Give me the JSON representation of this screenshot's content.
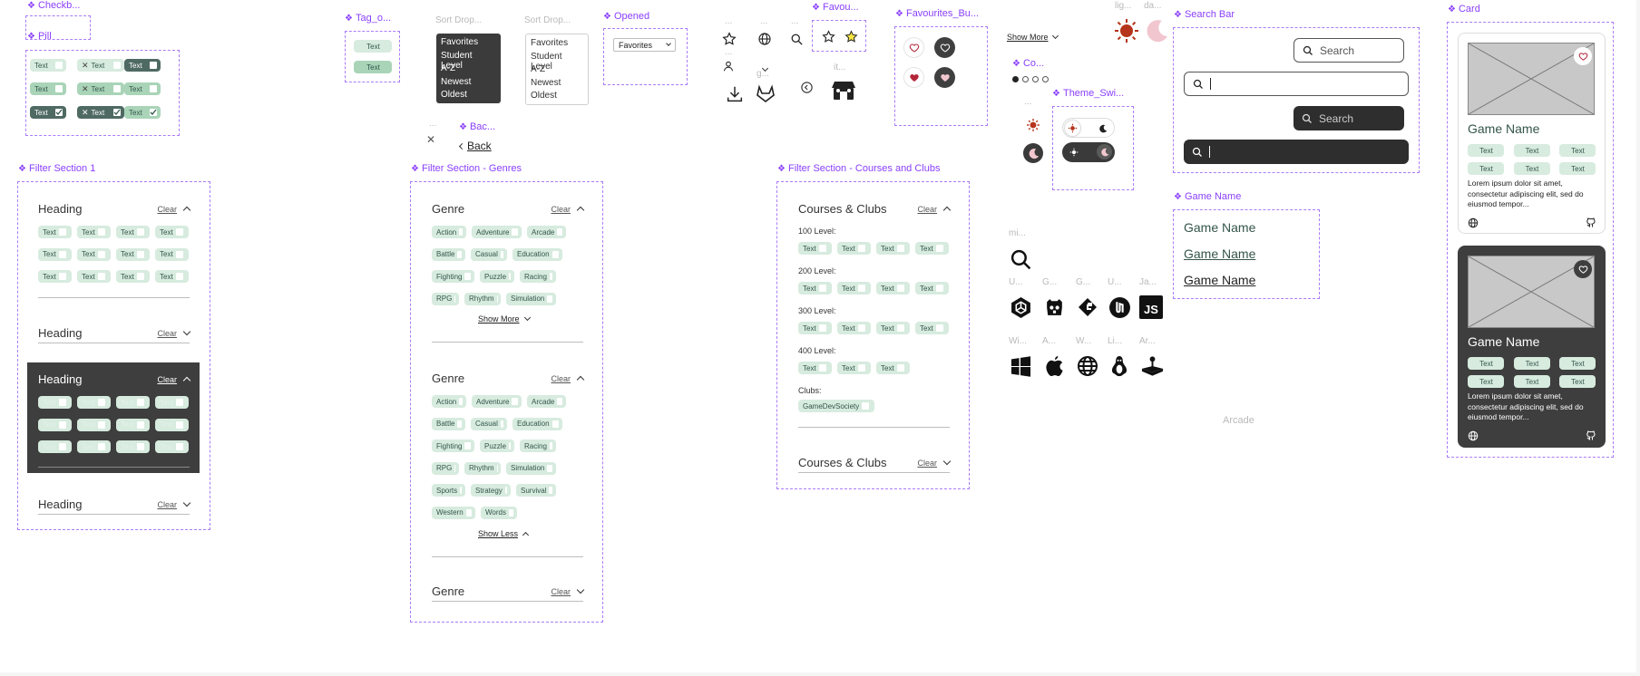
{
  "labels": {
    "checkbox": "Checkb...",
    "pill": "Pill",
    "tag": "Tag_o...",
    "sort1": "Sort Drop...",
    "sort2": "Sort Drop...",
    "opened": "Opened",
    "favou": "Favou...",
    "fav_buttons": "Favourites_Bu...",
    "search_bar": "Search Bar",
    "card": "Card",
    "back": "Bac...",
    "filter1": "Filter Section 1",
    "filter_genres": "Filter Section - Genres",
    "filter_courses": "Filter Section - Courses and Clubs",
    "co": "Co...",
    "theme": "Theme_Swi...",
    "game_name": "Game Name",
    "ghost_dots1": "...",
    "ghost_dots2": "...",
    "ghost_dots3": "...",
    "ghost_dots4": "...",
    "ghost_g": "g...",
    "ghost_it": "it...",
    "ghost_lig": "lig...",
    "ghost_da": "da...",
    "ghost_mi": "mi...",
    "ghost_dots5": "...",
    "ghost_row1": [
      "U...",
      "G...",
      "G...",
      "U...",
      "Ja..."
    ],
    "ghost_row2": [
      "Wi...",
      "A...",
      "W...",
      "Li...",
      "Ar..."
    ],
    "ghost_back_dots": "..."
  },
  "pill_text": "Text",
  "tag_text": "Text",
  "sort_options": [
    "Favorites",
    "Student Level",
    "A-Z",
    "Newest",
    "Oldest"
  ],
  "opened_value": "Favorites",
  "show_more_text": "Show More",
  "show_less_text": "Show Less",
  "back_text": "Back",
  "clear_text": "Clear",
  "filter1": {
    "heading": "Heading"
  },
  "genres": {
    "heading": "Genre",
    "list_short": [
      "Action",
      "Adventure",
      "Arcade",
      "Battle",
      "Casual",
      "Education",
      "Fighting",
      "Puzzle",
      "Racing",
      "RPG",
      "Rhythm",
      "Simulation"
    ],
    "list_full": [
      "Action",
      "Adventure",
      "Arcade",
      "Battle",
      "Casual",
      "Education",
      "Fighting",
      "Puzzle",
      "Racing",
      "RPG",
      "Rhythm",
      "Simulation",
      "Sports",
      "Strategy",
      "Survival",
      "Western",
      "Words"
    ]
  },
  "courses": {
    "heading": "Courses & Clubs",
    "levels": [
      "100 Level:",
      "200 Level:",
      "300 Level:",
      "400 Level:"
    ],
    "clubs_label": "Clubs:",
    "club": "GameDevSociety"
  },
  "search": {
    "placeholder": "Search"
  },
  "game_names": [
    "Game Name",
    "Game Name",
    "Game Name"
  ],
  "card": {
    "title": "Game Name",
    "desc": "Lorem ipsum dolor sit amet, consectetur adipiscing elit, sed do eiusmod tempor..."
  },
  "arcade_label": "Arcade",
  "colors": {
    "accent": "#8a3ffc",
    "pill_light": "#d7ebdf",
    "pill_mid": "#a9d4b8",
    "pill_dark": "#4f6a62",
    "dark_panel": "#3e3e3e",
    "sun": "#b5341b",
    "moon": "#f1c6ce"
  }
}
